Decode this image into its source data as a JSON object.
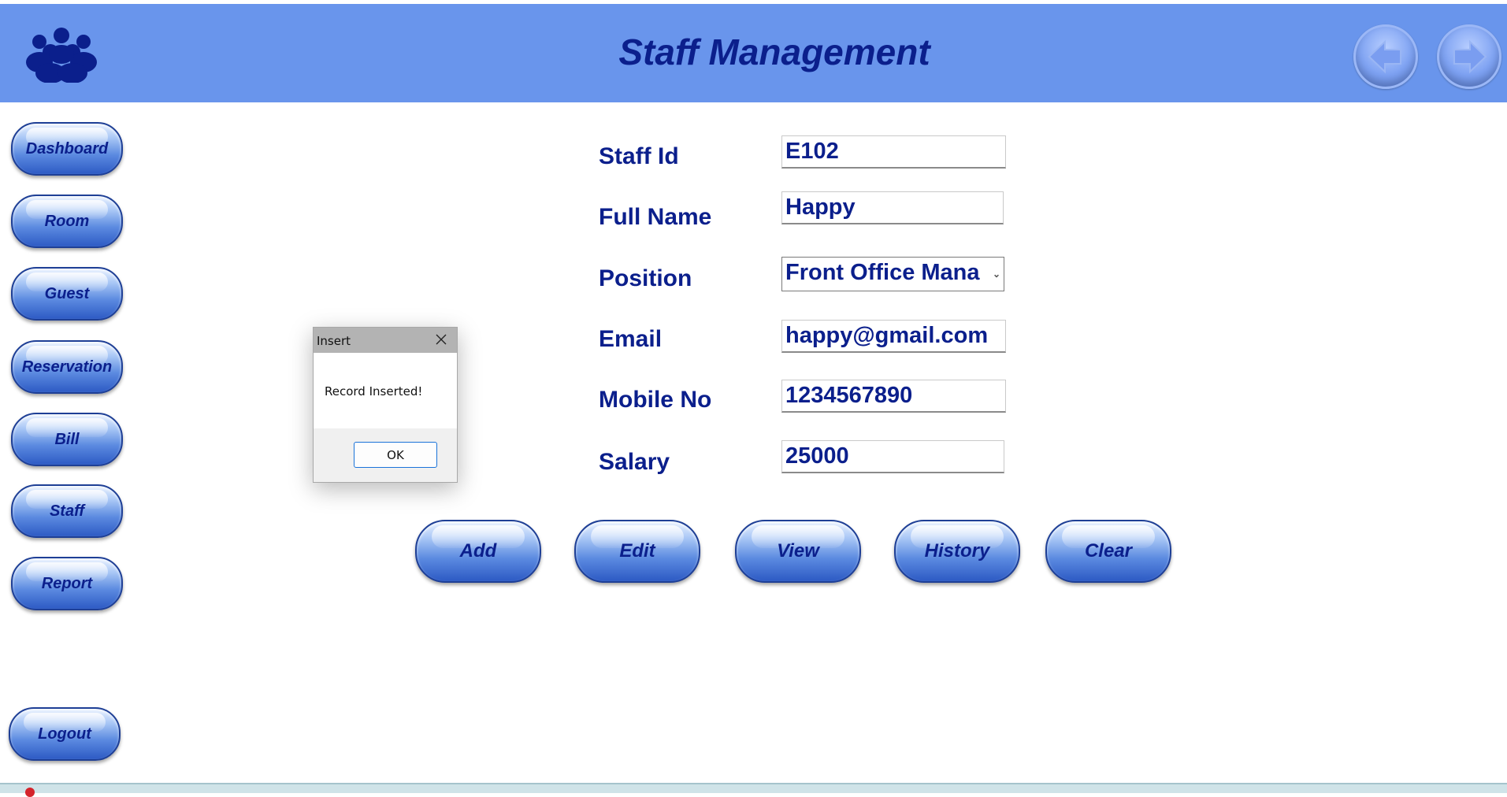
{
  "header": {
    "title": "Staff Management",
    "logo_icon": "people-group-icon",
    "back_icon": "arrow-left-icon",
    "forward_icon": "arrow-right-icon"
  },
  "sidebar": {
    "items": [
      {
        "label": "Dashboard"
      },
      {
        "label": "Room"
      },
      {
        "label": "Guest"
      },
      {
        "label": "Reservation"
      },
      {
        "label": "Bill"
      },
      {
        "label": "Staff"
      },
      {
        "label": "Report"
      }
    ],
    "logout_label": "Logout"
  },
  "form": {
    "staff_id": {
      "label": "Staff Id",
      "value": "E102"
    },
    "full_name": {
      "label": "Full Name",
      "value": "Happy"
    },
    "position": {
      "label": "Position",
      "value": "Front Office Mana"
    },
    "email": {
      "label": "Email",
      "value": "happy@gmail.com"
    },
    "mobile": {
      "label": "Mobile No",
      "value": "1234567890"
    },
    "salary": {
      "label": "Salary",
      "value": "25000"
    }
  },
  "actions": {
    "add": "Add",
    "edit": "Edit",
    "view": "View",
    "history": "History",
    "clear": "Clear"
  },
  "dialog": {
    "title": "Insert",
    "message": "Record Inserted!",
    "ok_label": "OK"
  },
  "colors": {
    "header_bg": "#6995ec",
    "text_primary": "#0b1f8c",
    "button_blue": "#5b8ae0"
  }
}
